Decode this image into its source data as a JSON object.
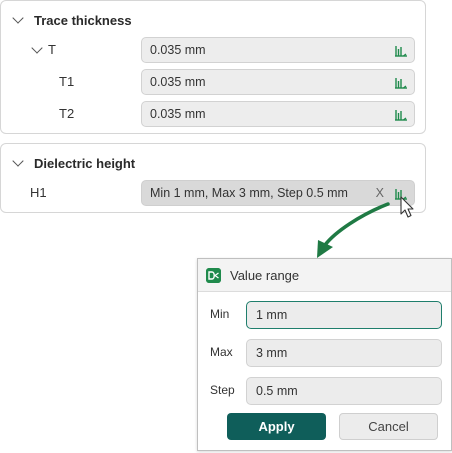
{
  "trace_section": {
    "title": "Trace thickness",
    "rows": [
      {
        "label": "T",
        "value": "0.035 mm"
      },
      {
        "label": "T1",
        "value": "0.035 mm"
      },
      {
        "label": "T2",
        "value": "0.035 mm"
      }
    ]
  },
  "dielectric_section": {
    "title": "Dielectric height",
    "rows": [
      {
        "label": "H1",
        "value": "Min 1 mm, Max 3 mm, Step 0.5 mm",
        "clear_label": "X"
      }
    ]
  },
  "popup": {
    "title": "Value range",
    "fields": {
      "min": {
        "label": "Min",
        "value": "1 mm"
      },
      "max": {
        "label": "Max",
        "value": "3 mm"
      },
      "step": {
        "label": "Step",
        "value": "0.5 mm"
      }
    },
    "apply_label": "Apply",
    "cancel_label": "Cancel"
  },
  "icons": {
    "section_toggle": "chevron-down-icon",
    "range_button": "value-range-icon",
    "popup_logo": "app-logo-icon",
    "pointer": "mouse-cursor-icon"
  },
  "colors": {
    "accent_green": "#1f8a4c",
    "apply_button": "#0f5e5a",
    "focus_border": "#1f7e6c"
  }
}
